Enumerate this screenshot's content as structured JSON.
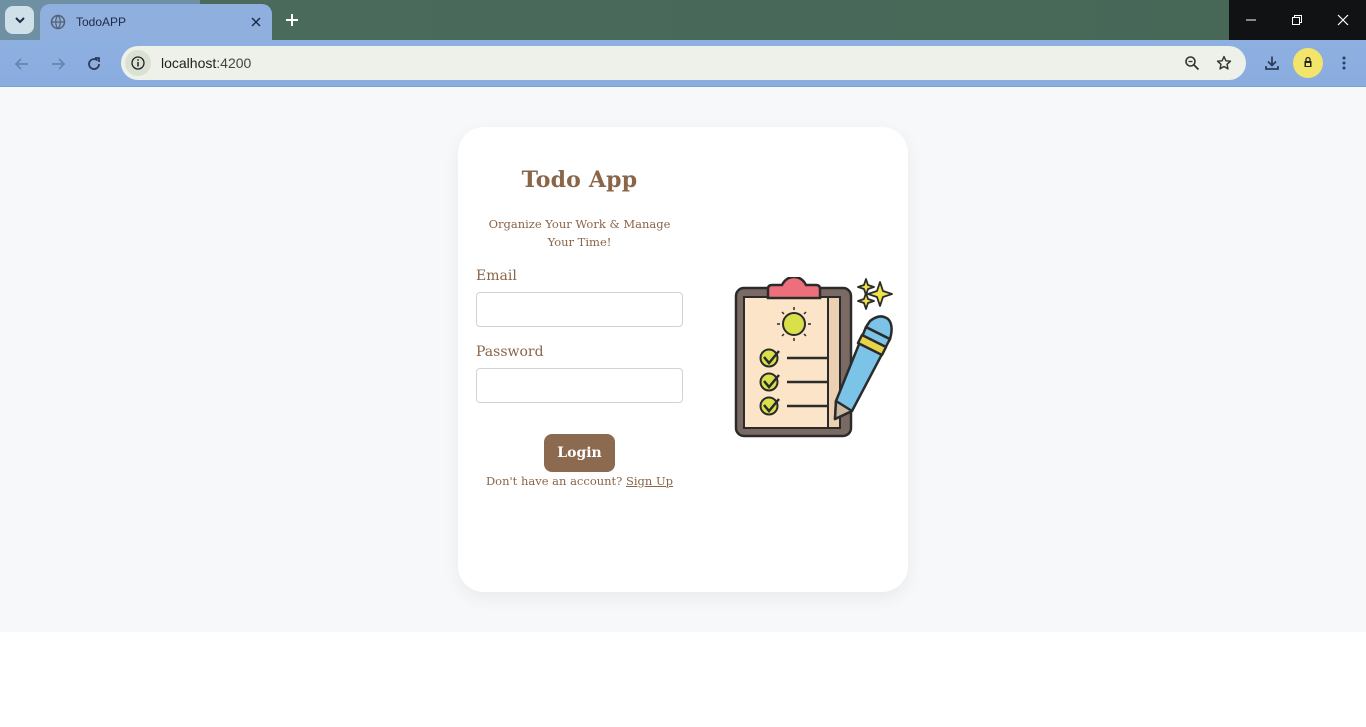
{
  "browser": {
    "tab_title": "TodoAPP",
    "url_host": "localhost",
    "url_port": ":4200",
    "icons": [
      "tab-search-icon",
      "globe-icon",
      "close-icon",
      "plus-icon",
      "minimize-icon",
      "restore-icon",
      "window-close-icon",
      "back-icon",
      "forward-icon",
      "reload-icon",
      "site-info-icon",
      "zoom-icon",
      "star-icon",
      "download-icon",
      "profile-icon",
      "menu-icon"
    ]
  },
  "login": {
    "title": "Todo App",
    "subtitle": "Organize Your Work & Manage Your Time!",
    "email_label": "Email",
    "email_value": "",
    "password_label": "Password",
    "password_value": "",
    "login_button": "Login",
    "signup_prompt": "Don't have an account?",
    "signup_link": "Sign Up"
  },
  "colors": {
    "brand_brown": "#8b6a4f",
    "page_bg": "#f7f8fa",
    "card_bg": "#ffffff"
  }
}
